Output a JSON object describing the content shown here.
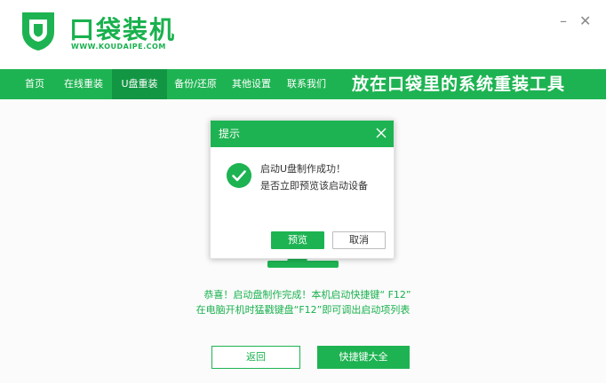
{
  "brand": {
    "name": "口袋装机",
    "subtitle": "WWW.KOUDAIPE.COM",
    "logo_icon": "shield-icon"
  },
  "window": {
    "minimize": "–",
    "close": "✕"
  },
  "nav": {
    "items": [
      {
        "label": "首页"
      },
      {
        "label": "在线重装"
      },
      {
        "label": "U盘重装"
      },
      {
        "label": "备份/还原"
      },
      {
        "label": "其他设置"
      },
      {
        "label": "联系我们"
      }
    ],
    "active_index": 2,
    "slogan": "放在口袋里的系统重装工具"
  },
  "dialog": {
    "title": "提示",
    "message_line1": "启动U盘制作成功！",
    "message_line2": "是否立即预览该启动设备",
    "preview_button": "预览",
    "cancel_button": "取消",
    "status_icon": "check-circle-icon",
    "close_icon": "close-icon"
  },
  "info": {
    "line1": "恭喜！启动盘制作完成！本机启动快捷键“ F12”",
    "line2": "在电脑开机时猛戳键盘“F12”即可调出启动项列表"
  },
  "buttons": {
    "back": "返回",
    "shortcuts": "快捷键大全"
  },
  "colors": {
    "accent": "#1eb352",
    "accent_dark": "#139644",
    "text": "#333333"
  }
}
